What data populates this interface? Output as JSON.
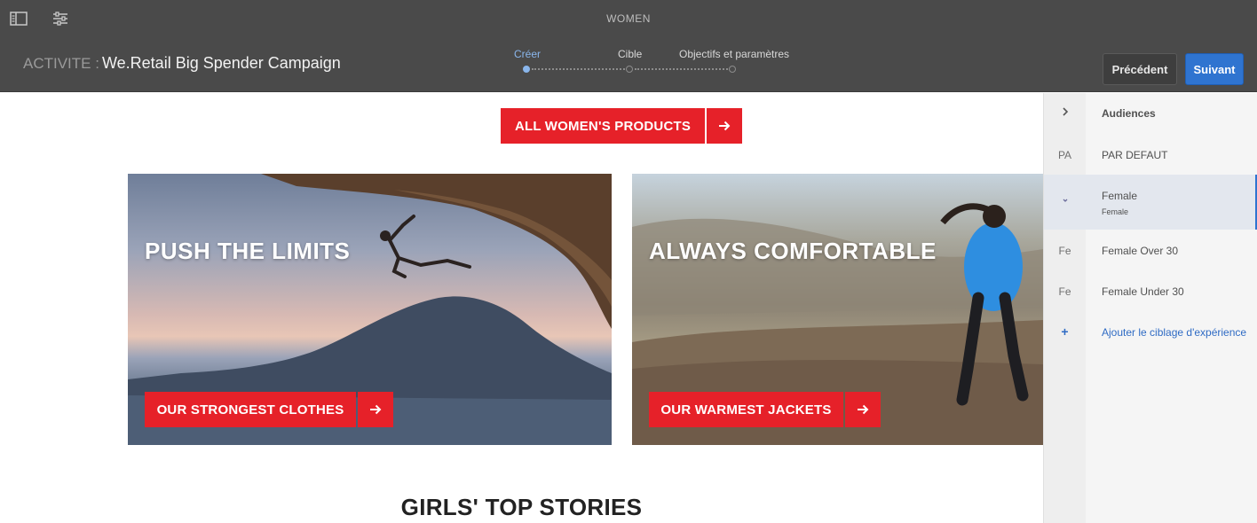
{
  "topbar": {
    "page_label": "WOMEN",
    "activity_prefix": "ACTIVITE :",
    "activity_name": "We.Retail Big Spender Campaign",
    "wizard_steps": [
      {
        "label": "Créer",
        "active": true
      },
      {
        "label": "Cible",
        "active": false
      },
      {
        "label": "Objectifs et paramètres",
        "active": false
      }
    ],
    "prev_label": "Précédent",
    "next_label": "Suivant",
    "icons": [
      "sidebar-toggle-icon",
      "properties-icon"
    ]
  },
  "content": {
    "top_cta": "ALL WOMEN'S PRODUCTS",
    "tiles": [
      {
        "title": "PUSH THE LIMITS",
        "cta": "OUR STRONGEST CLOTHES"
      },
      {
        "title": "ALWAYS COMFORTABLE",
        "cta": "OUR WARMEST JACKETS"
      }
    ],
    "section_title": "GIRLS' TOP STORIES"
  },
  "audiences": {
    "header": "Audiences",
    "items": [
      {
        "abbr": "PA",
        "label": "PAR DEFAUT",
        "sub": ""
      },
      {
        "abbr": "",
        "label": "Female",
        "sub": "Female"
      },
      {
        "abbr": "Fe",
        "label": "Female Over 30",
        "sub": ""
      },
      {
        "abbr": "Fe",
        "label": "Female Under 30",
        "sub": ""
      }
    ],
    "add_label": "Ajouter le ciblage d'expérience"
  },
  "colors": {
    "topbar_bg": "#4a4a4a",
    "primary_blue": "#2f74d0",
    "cta_red": "#e62129",
    "active_step": "#8ab6ec"
  }
}
